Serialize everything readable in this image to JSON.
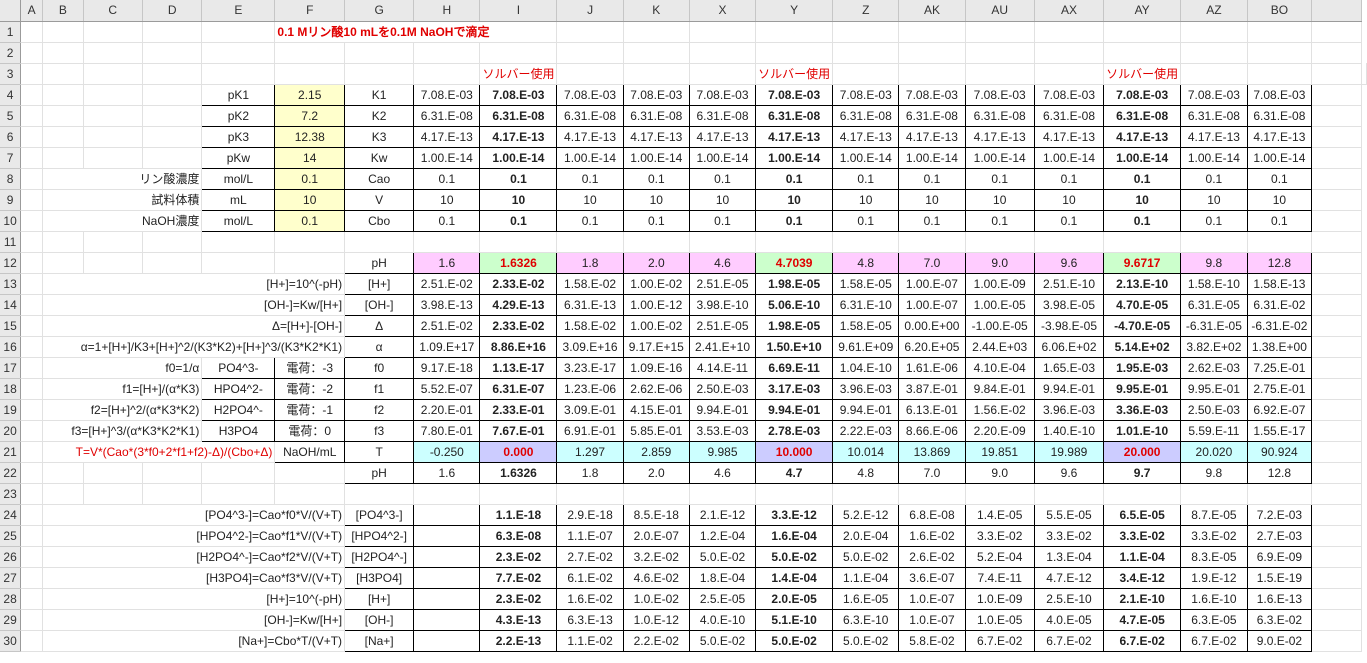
{
  "columns": [
    "A",
    "B",
    "C",
    "D",
    "E",
    "F",
    "G",
    "H",
    "I",
    "J",
    "K",
    "X",
    "Y",
    "Z",
    "AK",
    "AU",
    "AX",
    "AY",
    "AZ",
    "BO"
  ],
  "title": "0.1 Mリン酸10 mLを0.1M NaOHで滴定",
  "solver_label": "ソルバー使用",
  "params": [
    {
      "name": "pK1",
      "value": "2.15",
      "const": "K1"
    },
    {
      "name": "pK2",
      "value": "7.2",
      "const": "K2"
    },
    {
      "name": "pK3",
      "value": "12.38",
      "const": "K3"
    },
    {
      "name": "pKw",
      "value": "14",
      "const": "Kw"
    },
    {
      "desc": "リン酸濃度",
      "name": "mol/L",
      "value": "0.1",
      "const": "Cao"
    },
    {
      "desc": "試料体積",
      "name": "mL",
      "value": "10",
      "const": "V"
    },
    {
      "desc": "NaOH濃度",
      "name": "mol/L",
      "value": "0.1",
      "const": "Cbo"
    }
  ],
  "const_rows": [
    [
      "7.08.E-03",
      "7.08.E-03",
      "7.08.E-03",
      "7.08.E-03",
      "7.08.E-03",
      "7.08.E-03",
      "7.08.E-03",
      "7.08.E-03",
      "7.08.E-03",
      "7.08.E-03",
      "7.08.E-03",
      "7.08.E-03",
      "7.08.E-03"
    ],
    [
      "6.31.E-08",
      "6.31.E-08",
      "6.31.E-08",
      "6.31.E-08",
      "6.31.E-08",
      "6.31.E-08",
      "6.31.E-08",
      "6.31.E-08",
      "6.31.E-08",
      "6.31.E-08",
      "6.31.E-08",
      "6.31.E-08",
      "6.31.E-08"
    ],
    [
      "4.17.E-13",
      "4.17.E-13",
      "4.17.E-13",
      "4.17.E-13",
      "4.17.E-13",
      "4.17.E-13",
      "4.17.E-13",
      "4.17.E-13",
      "4.17.E-13",
      "4.17.E-13",
      "4.17.E-13",
      "4.17.E-13",
      "4.17.E-13"
    ],
    [
      "1.00.E-14",
      "1.00.E-14",
      "1.00.E-14",
      "1.00.E-14",
      "1.00.E-14",
      "1.00.E-14",
      "1.00.E-14",
      "1.00.E-14",
      "1.00.E-14",
      "1.00.E-14",
      "1.00.E-14",
      "1.00.E-14",
      "1.00.E-14"
    ],
    [
      "0.1",
      "0.1",
      "0.1",
      "0.1",
      "0.1",
      "0.1",
      "0.1",
      "0.1",
      "0.1",
      "0.1",
      "0.1",
      "0.1",
      "0.1"
    ],
    [
      "10",
      "10",
      "10",
      "10",
      "10",
      "10",
      "10",
      "10",
      "10",
      "10",
      "10",
      "10",
      "10"
    ],
    [
      "0.1",
      "0.1",
      "0.1",
      "0.1",
      "0.1",
      "0.1",
      "0.1",
      "0.1",
      "0.1",
      "0.1",
      "0.1",
      "0.1",
      "0.1"
    ]
  ],
  "calc_rows": [
    {
      "label": "",
      "g": "pH",
      "values": [
        "1.6",
        "1.6326",
        "1.8",
        "2.0",
        "4.6",
        "4.7039",
        "4.8",
        "7.0",
        "9.0",
        "9.6",
        "9.6717",
        "9.8",
        "12.8"
      ]
    },
    {
      "label": "[H+]=10^(-pH)",
      "g": "[H+]",
      "values": [
        "2.51.E-02",
        "2.33.E-02",
        "1.58.E-02",
        "1.00.E-02",
        "2.51.E-05",
        "1.98.E-05",
        "1.58.E-05",
        "1.00.E-07",
        "1.00.E-09",
        "2.51.E-10",
        "2.13.E-10",
        "1.58.E-10",
        "1.58.E-13"
      ]
    },
    {
      "label": "[OH-]=Kw/[H+]",
      "g": "[OH-]",
      "values": [
        "3.98.E-13",
        "4.29.E-13",
        "6.31.E-13",
        "1.00.E-12",
        "3.98.E-10",
        "5.06.E-10",
        "6.31.E-10",
        "1.00.E-07",
        "1.00.E-05",
        "3.98.E-05",
        "4.70.E-05",
        "6.31.E-05",
        "6.31.E-02"
      ]
    },
    {
      "label": "Δ=[H+]-[OH-]",
      "g": "Δ",
      "values": [
        "2.51.E-02",
        "2.33.E-02",
        "1.58.E-02",
        "1.00.E-02",
        "2.51.E-05",
        "1.98.E-05",
        "1.58.E-05",
        "0.00.E+00",
        "-1.00.E-05",
        "-3.98.E-05",
        "-4.70.E-05",
        "-6.31.E-05",
        "-6.31.E-02"
      ]
    },
    {
      "label": "α=1+[H+]/K3+[H+]^2/(K3*K2)+[H+]^3/(K3*K2*K1)",
      "g": "α",
      "values": [
        "1.09.E+17",
        "8.86.E+16",
        "3.09.E+16",
        "9.17.E+15",
        "2.41.E+10",
        "1.50.E+10",
        "9.61.E+09",
        "6.20.E+05",
        "2.44.E+03",
        "6.06.E+02",
        "5.14.E+02",
        "3.82.E+02",
        "1.38.E+00"
      ]
    },
    {
      "label": "f0=1/α",
      "e": "PO4^3-",
      "f": "電荷：-3",
      "g": "f0",
      "values": [
        "9.17.E-18",
        "1.13.E-17",
        "3.23.E-17",
        "1.09.E-16",
        "4.14.E-11",
        "6.69.E-11",
        "1.04.E-10",
        "1.61.E-06",
        "4.10.E-04",
        "1.65.E-03",
        "1.95.E-03",
        "2.62.E-03",
        "7.25.E-01"
      ]
    },
    {
      "label": "f1=[H+]/(α*K3)",
      "e": "HPO4^2-",
      "f": "電荷：-2",
      "g": "f1",
      "values": [
        "5.52.E-07",
        "6.31.E-07",
        "1.23.E-06",
        "2.62.E-06",
        "2.50.E-03",
        "3.17.E-03",
        "3.96.E-03",
        "3.87.E-01",
        "9.84.E-01",
        "9.94.E-01",
        "9.95.E-01",
        "9.95.E-01",
        "2.75.E-01"
      ]
    },
    {
      "label": "f2=[H+]^2/(α*K3*K2)",
      "e": "H2PO4^-",
      "f": "電荷：-1",
      "g": "f2",
      "values": [
        "2.20.E-01",
        "2.33.E-01",
        "3.09.E-01",
        "4.15.E-01",
        "9.94.E-01",
        "9.94.E-01",
        "9.94.E-01",
        "6.13.E-01",
        "1.56.E-02",
        "3.96.E-03",
        "3.36.E-03",
        "2.50.E-03",
        "6.92.E-07"
      ]
    },
    {
      "label": "f3=[H+]^3/(α*K3*K2*K1)",
      "e": "H3PO4",
      "f": "電荷：0",
      "g": "f3",
      "values": [
        "7.80.E-01",
        "7.67.E-01",
        "6.91.E-01",
        "5.85.E-01",
        "3.53.E-03",
        "2.78.E-03",
        "2.22.E-03",
        "8.66.E-06",
        "2.20.E-09",
        "1.40.E-10",
        "1.01.E-10",
        "5.59.E-11",
        "1.55.E-17"
      ]
    },
    {
      "label": "T=V*(Cao*(3*f0+2*f1+f2)-Δ)/(Cbo+Δ)",
      "f": "NaOH/mL",
      "g": "T",
      "values": [
        "-0.250",
        "0.000",
        "1.297",
        "2.859",
        "9.985",
        "10.000",
        "10.014",
        "13.869",
        "19.851",
        "19.989",
        "20.000",
        "20.020",
        "90.924"
      ]
    },
    {
      "label": "",
      "g": "pH",
      "values": [
        "1.6",
        "1.6326",
        "1.8",
        "2.0",
        "4.6",
        "4.7",
        "4.8",
        "7.0",
        "9.0",
        "9.6",
        "9.7",
        "9.8",
        "12.8"
      ]
    }
  ],
  "conc_rows": [
    {
      "label": "[PO4^3-]=Cao*f0*V/(V+T)",
      "g": "[PO4^3-]",
      "values": [
        "",
        "1.1.E-18",
        "2.9.E-18",
        "8.5.E-18",
        "2.1.E-12",
        "3.3.E-12",
        "5.2.E-12",
        "6.8.E-08",
        "1.4.E-05",
        "5.5.E-05",
        "6.5.E-05",
        "8.7.E-05",
        "7.2.E-03"
      ]
    },
    {
      "label": "[HPO4^2-]=Cao*f1*V/(V+T)",
      "g": "[HPO4^2-]",
      "values": [
        "",
        "6.3.E-08",
        "1.1.E-07",
        "2.0.E-07",
        "1.2.E-04",
        "1.6.E-04",
        "2.0.E-04",
        "1.6.E-02",
        "3.3.E-02",
        "3.3.E-02",
        "3.3.E-02",
        "3.3.E-02",
        "2.7.E-03"
      ]
    },
    {
      "label": "[H2PO4^-]=Cao*f2*V/(V+T)",
      "g": "[H2PO4^-]",
      "values": [
        "",
        "2.3.E-02",
        "2.7.E-02",
        "3.2.E-02",
        "5.0.E-02",
        "5.0.E-02",
        "5.0.E-02",
        "2.6.E-02",
        "5.2.E-04",
        "1.3.E-04",
        "1.1.E-04",
        "8.3.E-05",
        "6.9.E-09"
      ]
    },
    {
      "label": "[H3PO4]=Cao*f3*V/(V+T)",
      "g": "[H3PO4]",
      "values": [
        "",
        "7.7.E-02",
        "6.1.E-02",
        "4.6.E-02",
        "1.8.E-04",
        "1.4.E-04",
        "1.1.E-04",
        "3.6.E-07",
        "7.4.E-11",
        "4.7.E-12",
        "3.4.E-12",
        "1.9.E-12",
        "1.5.E-19"
      ]
    },
    {
      "label": "[H+]=10^(-pH)",
      "g": "[H+]",
      "values": [
        "",
        "2.3.E-02",
        "1.6.E-02",
        "1.0.E-02",
        "2.5.E-05",
        "2.0.E-05",
        "1.6.E-05",
        "1.0.E-07",
        "1.0.E-09",
        "2.5.E-10",
        "2.1.E-10",
        "1.6.E-10",
        "1.6.E-13"
      ]
    },
    {
      "label": "[OH-]=Kw/[H+]",
      "g": "[OH-]",
      "values": [
        "",
        "4.3.E-13",
        "6.3.E-13",
        "1.0.E-12",
        "4.0.E-10",
        "5.1.E-10",
        "6.3.E-10",
        "1.0.E-07",
        "1.0.E-05",
        "4.0.E-05",
        "4.7.E-05",
        "6.3.E-05",
        "6.3.E-02"
      ]
    },
    {
      "label": "[Na+]=Cbo*T/(V+T)",
      "g": "[Na+]",
      "values": [
        "",
        "2.2.E-13",
        "1.1.E-02",
        "2.2.E-02",
        "5.0.E-02",
        "5.0.E-02",
        "5.0.E-02",
        "5.8.E-02",
        "6.7.E-02",
        "6.7.E-02",
        "6.7.E-02",
        "6.7.E-02",
        "9.0.E-02"
      ]
    }
  ]
}
